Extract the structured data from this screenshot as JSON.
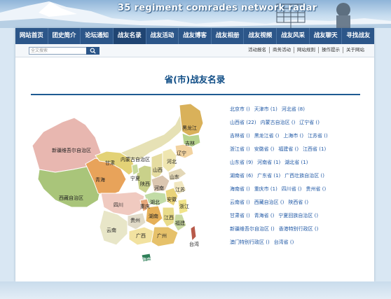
{
  "banner": {
    "title": "35 regiment comrades network radar"
  },
  "nav": {
    "items": [
      {
        "label": "网站首页"
      },
      {
        "label": "团史简介"
      },
      {
        "label": "论坛通知"
      },
      {
        "label": "战友名录"
      },
      {
        "label": "战友活动"
      },
      {
        "label": "战友博客"
      },
      {
        "label": "战友相册"
      },
      {
        "label": "战友视频"
      },
      {
        "label": "战友风采"
      },
      {
        "label": "战友聊天"
      },
      {
        "label": "寻找战友"
      }
    ]
  },
  "search": {
    "placeholder": "全文搜索"
  },
  "quick_links": [
    {
      "label": "活动报名"
    },
    {
      "label": "商务活动"
    },
    {
      "label": "网站规则"
    },
    {
      "label": "操作提示"
    },
    {
      "label": "关于网站"
    }
  ],
  "page": {
    "title": "省(市)战友名录"
  },
  "map_labels": [
    {
      "text": "新疆维吾尔自治区"
    },
    {
      "text": "西藏自治区"
    },
    {
      "text": "青海"
    },
    {
      "text": "甘肃"
    },
    {
      "text": "内蒙古自治区"
    },
    {
      "text": "黑龙江"
    },
    {
      "text": "吉林"
    },
    {
      "text": "辽宁"
    },
    {
      "text": "河北"
    },
    {
      "text": "山西"
    },
    {
      "text": "山东"
    },
    {
      "text": "宁夏"
    },
    {
      "text": "陕西"
    },
    {
      "text": "河南"
    },
    {
      "text": "江苏"
    },
    {
      "text": "四川"
    },
    {
      "text": "湖北"
    },
    {
      "text": "安徽"
    },
    {
      "text": "浙江"
    },
    {
      "text": "重庆"
    },
    {
      "text": "贵州"
    },
    {
      "text": "湖南"
    },
    {
      "text": "江西"
    },
    {
      "text": "福建"
    },
    {
      "text": "云南"
    },
    {
      "text": "广西"
    },
    {
      "text": "广州"
    },
    {
      "text": "台湾"
    },
    {
      "text": "海南"
    }
  ],
  "provinces": [
    [
      "北京市 ()",
      "天津市 (1)",
      "河北省 (8)"
    ],
    [
      "山西省 (22)",
      "内蒙古自治区 ()",
      "辽宁省 ()"
    ],
    [
      "吉林省 ()",
      "黑龙江省 ()",
      "上海市 ()",
      "江苏省 ()"
    ],
    [
      "浙江省 ()",
      "安徽省 ()",
      "福建省 ()",
      "江西省 (1)"
    ],
    [
      "山东省 (9)",
      "河南省 (1)",
      "湖北省 (1)"
    ],
    [
      "湖南省 (6)",
      "广东省 (1)",
      "广西壮族自治区 ()"
    ],
    [
      "海南省 ()",
      "重庆市 (1)",
      "四川省 ()",
      "贵州省 ()"
    ],
    [
      "云南省 ()",
      "西藏自治区 ()",
      "陕西省 ()"
    ],
    [
      "甘肃省 ()",
      "青海省 ()",
      "宁夏回族自治区 ()"
    ],
    [
      "新疆维吾尔自治区 ()",
      "香港特别行政区 ()"
    ],
    [
      "澳门特别行政区 ()",
      "台湾省 ()"
    ]
  ]
}
